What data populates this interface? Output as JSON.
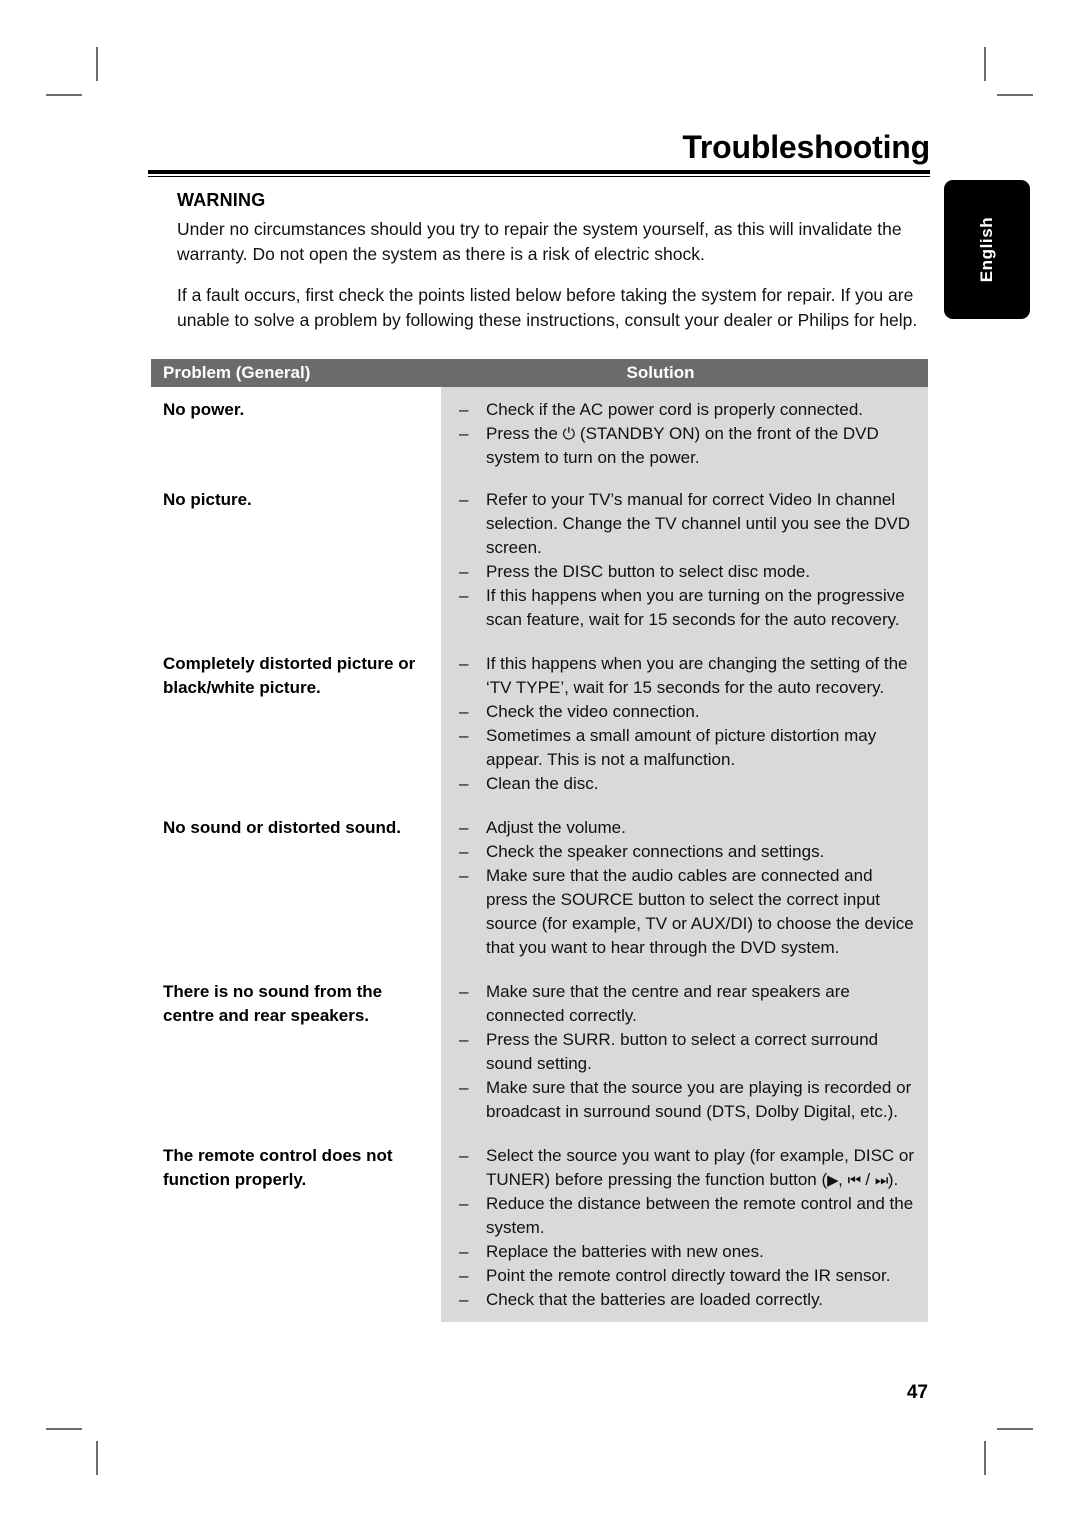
{
  "page": {
    "chapter_title": "Troubleshooting",
    "page_number": "47",
    "language_tab": "English"
  },
  "warning": {
    "heading": "WARNING",
    "paragraph_1": "Under no circumstances should you try to repair the system yourself, as this will invalidate the warranty. Do not open the system as there is a risk of electric shock.",
    "paragraph_2": "If a fault occurs, first check the points listed below before taking the system for repair. If you are unable to solve a problem by following these instructions, consult your dealer or Philips for help."
  },
  "table": {
    "headers": {
      "problem": "Problem (General)",
      "solution": "Solution"
    },
    "rows": [
      {
        "problem": "No power.",
        "solutions": [
          "Check if the AC power cord is properly connected.",
          "Press the ⏻ (STANDBY ON) on the front of the DVD system to turn on the power."
        ]
      },
      {
        "problem": "No picture.",
        "solutions": [
          "Refer to your TV’s manual for correct Video In channel selection. Change the TV channel until you see the DVD screen.",
          "Press the DISC button to select disc mode.",
          "If this happens when you are turning on the progressive scan feature, wait for 15 seconds for the auto recovery."
        ]
      },
      {
        "problem": "Completely distorted picture or black/white picture.",
        "solutions": [
          "If this happens when you are changing the setting of the ‘TV TYPE’, wait for 15 seconds for the auto recovery.",
          "Check the video connection.",
          "Sometimes a small amount of picture distortion may appear. This is not a malfunction.",
          "Clean the disc."
        ]
      },
      {
        "problem": "No sound or distorted sound.",
        "solutions": [
          "Adjust the volume.",
          "Check the speaker connections and settings.",
          "Make sure that the audio cables are connected and press the SOURCE button to select the correct input source (for example, TV or AUX/DI) to choose the device that you want to hear through the DVD system."
        ]
      },
      {
        "problem": "There is no sound from the centre and rear speakers.",
        "solutions": [
          "Make sure that the centre and rear speakers are connected correctly.",
          "Press the SURR. button to select a correct surround sound setting.",
          "Make sure that the source you are playing is recorded or broadcast in surround sound (DTS, Dolby Digital, etc.)."
        ]
      },
      {
        "problem": "The remote control does not function properly.",
        "solutions": [
          "Select the source you want to play (for example, DISC or TUNER) before pressing the function button (▶, ⏮ / ⏭).",
          "Reduce the distance between the remote control and the system.",
          "Replace the batteries with new ones.",
          "Point the remote control directly toward the IR sensor.",
          "Check that the batteries are loaded correctly."
        ]
      }
    ],
    "bullet_dash": "–"
  },
  "colors": {
    "header_bar": "#6b6b6b",
    "solution_cell": "#d9d9d9",
    "tab_background": "#000000",
    "crop_mark": "#6e6e6e"
  }
}
